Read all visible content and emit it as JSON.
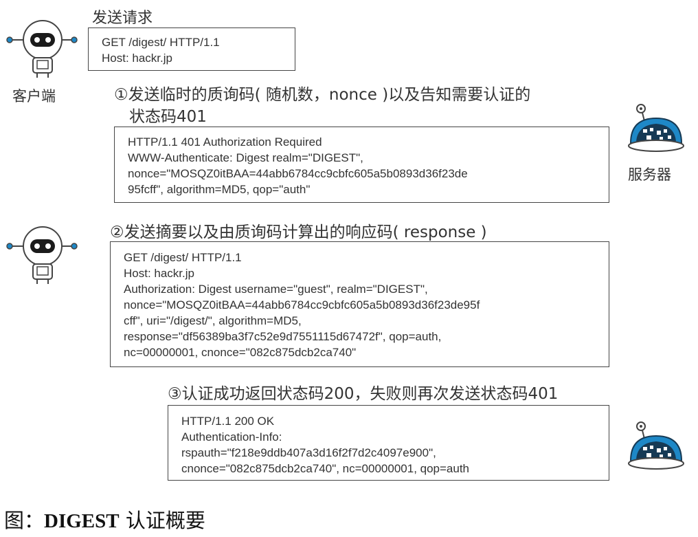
{
  "send_request_label": "发送请求",
  "client_label": "客户端",
  "server_label": "服务器",
  "request1": {
    "lines": [
      "GET /digest/ HTTP/1.1",
      "Host: hackr.jp"
    ]
  },
  "step1": {
    "lines": [
      "①发送临时的质询码( 随机数，nonce )以及告知需要认证的",
      "状态码401"
    ]
  },
  "response1": {
    "lines": [
      "HTTP/1.1 401 Authorization Required",
      "WWW-Authenticate: Digest realm=\"DIGEST\",",
      "nonce=\"MOSQZ0itBAA=44abb6784cc9cbfc605a5b0893d36f23de",
      "95fcff\", algorithm=MD5, qop=\"auth\""
    ]
  },
  "step2": {
    "text": "②发送摘要以及由质询码计算出的响应码( response )"
  },
  "request2": {
    "lines": [
      "GET /digest/ HTTP/1.1",
      "Host: hackr.jp",
      "Authorization: Digest username=\"guest\", realm=\"DIGEST\",",
      "nonce=\"MOSQZ0itBAA=44abb6784cc9cbfc605a5b0893d36f23de95f",
      "cff\", uri=\"/digest/\", algorithm=MD5,",
      "response=\"df56389ba3f7c52e9d7551115d67472f\", qop=auth,",
      "nc=00000001, cnonce=\"082c875dcb2ca740\""
    ]
  },
  "step3": {
    "text": "③认证成功返回状态码200，失败则再次发送状态码401"
  },
  "response2": {
    "lines": [
      "HTTP/1.1 200 OK",
      "Authentication-Info:",
      "rspauth=\"f218e9ddb407a3d16f2f7d2c4097e900\",",
      "cnonce=\"082c875dcb2ca740\", nc=00000001, qop=auth"
    ]
  },
  "caption": {
    "prefix": "图：",
    "bold": "DIGEST",
    "suffix": " 认证概要"
  },
  "colors": {
    "robot_body": "#ffffff",
    "robot_face": "#1b1b1b",
    "server_blue": "#1e88c7",
    "server_dark": "#163a55",
    "line": "#444444"
  },
  "icons": [
    "client-robot-icon",
    "server-dome-icon"
  ]
}
